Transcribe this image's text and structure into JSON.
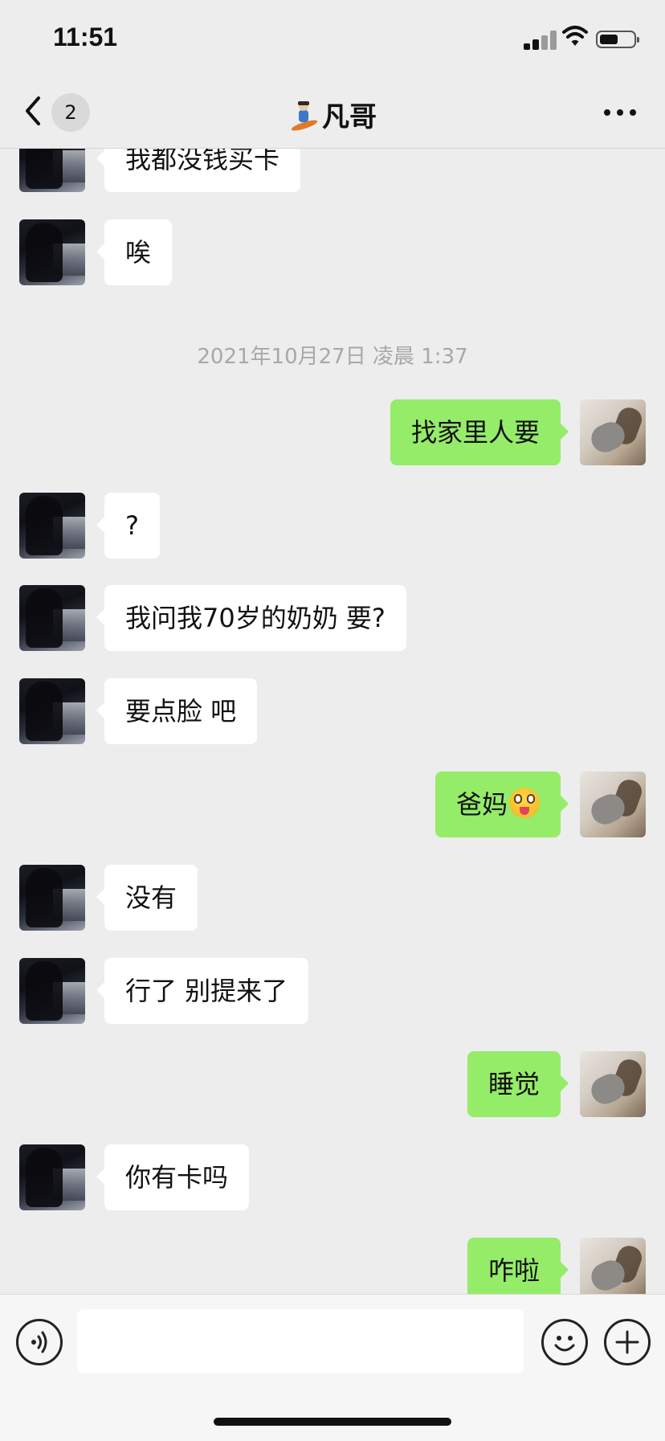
{
  "status_bar": {
    "time": "11:51"
  },
  "nav": {
    "unread_count": "2",
    "title": "凡哥"
  },
  "timestamp": "2021年10月27日 凌晨 1:37",
  "messages": [
    {
      "side": "left",
      "text": "我都没钱买卡"
    },
    {
      "side": "left",
      "text": "唉"
    },
    {
      "side": "right",
      "text": "找家里人要"
    },
    {
      "side": "left",
      "text": "?"
    },
    {
      "side": "left",
      "text": "我问我70岁的奶奶 要?"
    },
    {
      "side": "left",
      "text": "要点脸 吧"
    },
    {
      "side": "right",
      "text": "爸妈",
      "emoji": "astonished-tongue-emoji"
    },
    {
      "side": "left",
      "text": "没有"
    },
    {
      "side": "left",
      "text": "行了 别提来了"
    },
    {
      "side": "right",
      "text": "睡觉"
    },
    {
      "side": "left",
      "text": "你有卡吗"
    },
    {
      "side": "right",
      "text": "咋啦"
    }
  ],
  "icons": {
    "back": "chevron-left-icon",
    "title_emoji": "snowboarder-emoji",
    "more": "more-dots-icon",
    "voice": "voice-icon",
    "emoji": "emoji-icon",
    "plus": "plus-icon"
  },
  "colors": {
    "background": "#ededed",
    "bubble_left": "#ffffff",
    "bubble_right": "#95ec69",
    "timestamp": "#a8a8a8"
  }
}
